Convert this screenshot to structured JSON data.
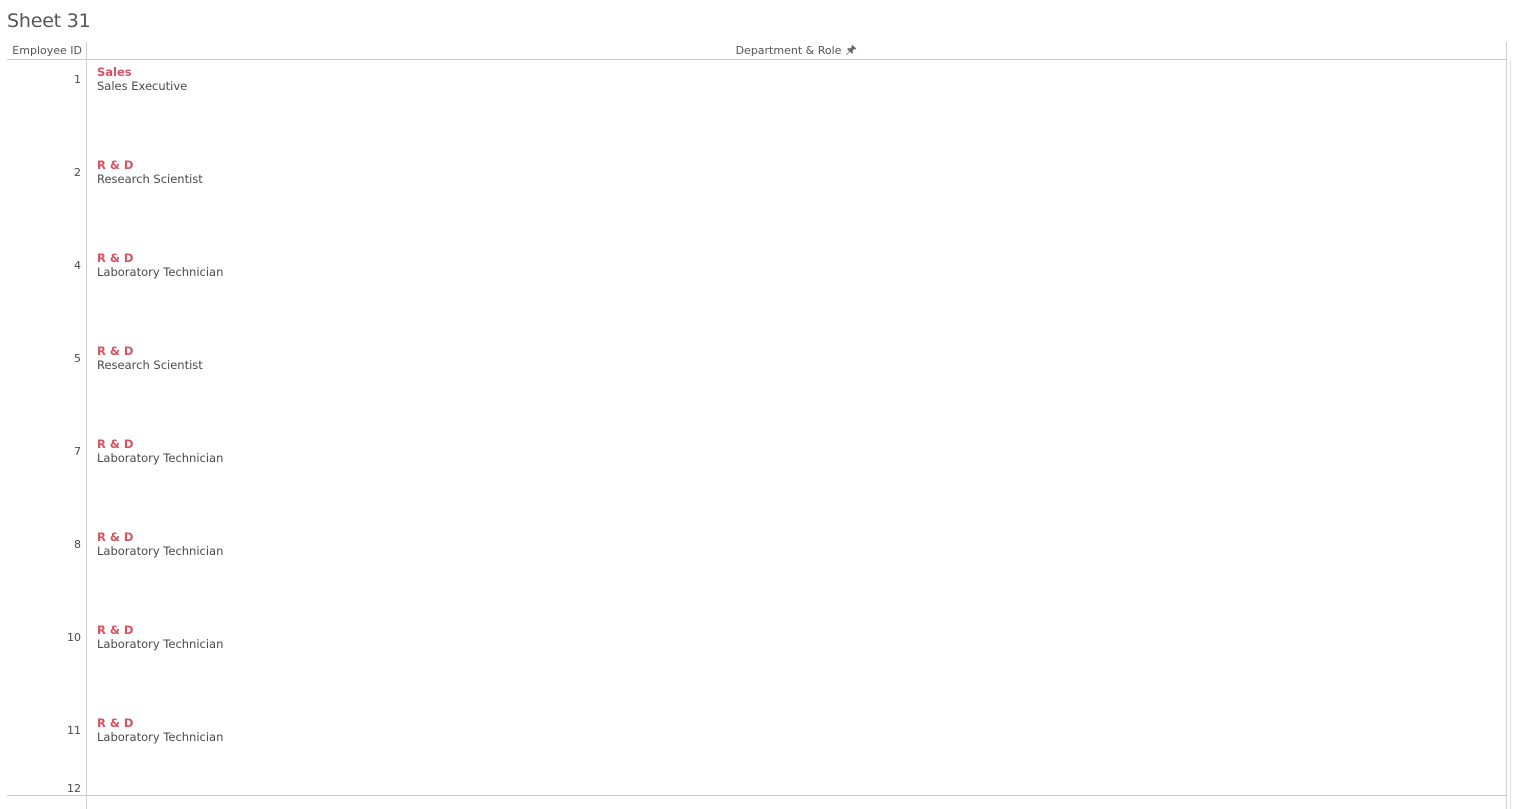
{
  "sheet": {
    "title": "Sheet 31"
  },
  "header": {
    "employee_id_label": "Employee ID",
    "department_role_label": "Department & Role",
    "pin_icon": "pin-icon"
  },
  "colors": {
    "department_text": "#d6535f",
    "role_text": "#4a4a4a"
  },
  "rows": [
    {
      "id": "1",
      "department": "Sales",
      "role": "Sales Executive"
    },
    {
      "id": "2",
      "department": "R & D",
      "role": "Research Scientist"
    },
    {
      "id": "4",
      "department": "R & D",
      "role": "Laboratory Technician"
    },
    {
      "id": "5",
      "department": "R & D",
      "role": "Research Scientist"
    },
    {
      "id": "7",
      "department": "R & D",
      "role": "Laboratory Technician"
    },
    {
      "id": "8",
      "department": "R & D",
      "role": "Laboratory Technician"
    },
    {
      "id": "10",
      "department": "R & D",
      "role": "Laboratory Technician"
    },
    {
      "id": "11",
      "department": "R & D",
      "role": "Laboratory Technician"
    },
    {
      "id": "12",
      "department": "",
      "role": ""
    }
  ]
}
